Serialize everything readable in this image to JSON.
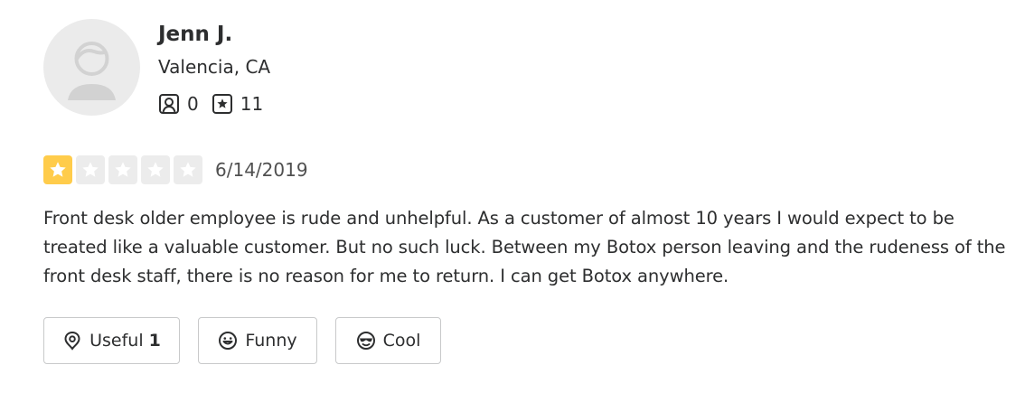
{
  "user": {
    "name": "Jenn J.",
    "location": "Valencia, CA",
    "friends_count": "0",
    "reviews_count": "11"
  },
  "review": {
    "rating": 1,
    "max_rating": 5,
    "date": "6/14/2019",
    "text": "Front desk older employee is rude and unhelpful. As a customer of almost 10 years I would expect to be treated like a valuable customer. But no such luck. Between my Botox person leaving and the rudeness of the front desk staff, there is no reason for me to return. I can get Botox anywhere."
  },
  "reactions": {
    "useful_label": "Useful",
    "useful_count": "1",
    "funny_label": "Funny",
    "cool_label": "Cool"
  },
  "colors": {
    "star_filled": "#ffcc4b",
    "star_empty": "#ececec",
    "text": "#2d2e2f",
    "avatar_bg": "#ebebeb"
  },
  "icons": {
    "avatar": "user-silhouette-icon",
    "friends": "friends-icon",
    "reviews": "review-star-icon",
    "useful": "lightbulb-icon",
    "funny": "smile-icon",
    "cool": "sunglasses-icon"
  }
}
